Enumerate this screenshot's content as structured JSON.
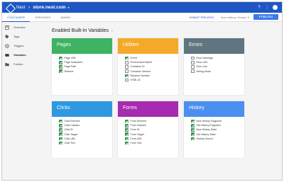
{
  "appbar": {
    "app_name": "Nest",
    "separator": ">",
    "container": "store.nest.com",
    "caret": "▾",
    "help_icon": "?",
    "more_icon": "⋮"
  },
  "subnav": {
    "tabs": [
      {
        "label": "CONTAINER",
        "active": true
      },
      {
        "label": "VERSIONS",
        "active": false
      },
      {
        "label": "ADMIN",
        "active": false
      }
    ],
    "submit_preview": "SUBMIT PREVIEW",
    "workspace_info": "Now editing: Version 3",
    "publish_label": "PUBLISH"
  },
  "sidebar": {
    "items": [
      {
        "label": "Overview",
        "icon": "overview-icon",
        "active": false
      },
      {
        "label": "Tags",
        "icon": "tag-icon",
        "active": false
      },
      {
        "label": "Triggers",
        "icon": "trigger-icon",
        "active": false
      },
      {
        "label": "Variables",
        "icon": "variable-icon",
        "active": true
      },
      {
        "label": "Folders",
        "icon": "folder-icon",
        "active": false
      }
    ]
  },
  "main": {
    "title": "Enabled Built-In Variables",
    "title_chevron": "›"
  },
  "cards": [
    {
      "title": "Pages",
      "color": "#3db363",
      "items": [
        {
          "label": "Page URL",
          "checked": true
        },
        {
          "label": "Page Hostname",
          "checked": true
        },
        {
          "label": "Page Path",
          "checked": true
        },
        {
          "label": "Referrer",
          "checked": true
        }
      ]
    },
    {
      "title": "Utilities",
      "color": "#f4a928",
      "items": [
        {
          "label": "Event",
          "checked": true
        },
        {
          "label": "Environment Name",
          "checked": false
        },
        {
          "label": "Container ID",
          "checked": false
        },
        {
          "label": "Container Version",
          "checked": false
        },
        {
          "label": "Random Number",
          "checked": true
        },
        {
          "label": "HTML ID",
          "checked": false
        }
      ]
    },
    {
      "title": "Errors",
      "color": "#5f7580",
      "items": [
        {
          "label": "Error Message",
          "checked": false
        },
        {
          "label": "Error URL",
          "checked": false
        },
        {
          "label": "Error Line",
          "checked": false
        },
        {
          "label": "Debug Mode",
          "checked": false
        }
      ]
    },
    {
      "title": "Clicks",
      "color": "#2e99e0",
      "items": [
        {
          "label": "Click Element",
          "checked": true
        },
        {
          "label": "Click Classes",
          "checked": true
        },
        {
          "label": "Click ID",
          "checked": true
        },
        {
          "label": "Click Target",
          "checked": true
        },
        {
          "label": "Click URL",
          "checked": true
        },
        {
          "label": "Click Text",
          "checked": true
        }
      ]
    },
    {
      "title": "Forms",
      "color": "#a62bb0",
      "items": [
        {
          "label": "Form Element",
          "checked": true
        },
        {
          "label": "Form Classes",
          "checked": true
        },
        {
          "label": "Form ID",
          "checked": true
        },
        {
          "label": "Form Target",
          "checked": true
        },
        {
          "label": "Form URL",
          "checked": true
        },
        {
          "label": "Form Text",
          "checked": true
        }
      ]
    },
    {
      "title": "History",
      "color": "#4b8ff0",
      "items": [
        {
          "label": "New History Fragment",
          "checked": true
        },
        {
          "label": "Old History Fragment",
          "checked": true
        },
        {
          "label": "New History State",
          "checked": true
        },
        {
          "label": "Old History State",
          "checked": true
        },
        {
          "label": "History Source",
          "checked": true
        }
      ]
    }
  ]
}
